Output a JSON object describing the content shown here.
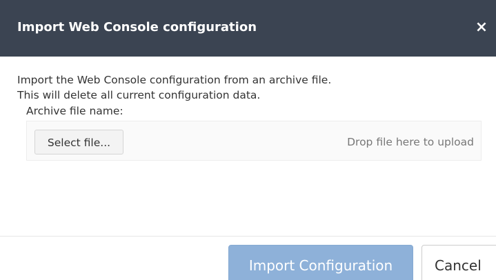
{
  "dialog": {
    "title": "Import Web Console configuration",
    "close_icon": "close-icon",
    "close_glyph": "×",
    "description_line1": "Import the Web Console configuration from an archive file.",
    "description_line2": "This will delete all current configuration data.",
    "field_label": "Archive file name:",
    "upload": {
      "select_button_label": "Select file...",
      "drop_hint": "Drop file here to upload"
    },
    "footer": {
      "import_button_label": "Import Configuration",
      "cancel_button_label": "Cancel"
    }
  },
  "colors": {
    "titlebar": "#3b4452",
    "primary_button": "#8eb1d9",
    "text": "#333333",
    "muted_text": "#777777"
  }
}
